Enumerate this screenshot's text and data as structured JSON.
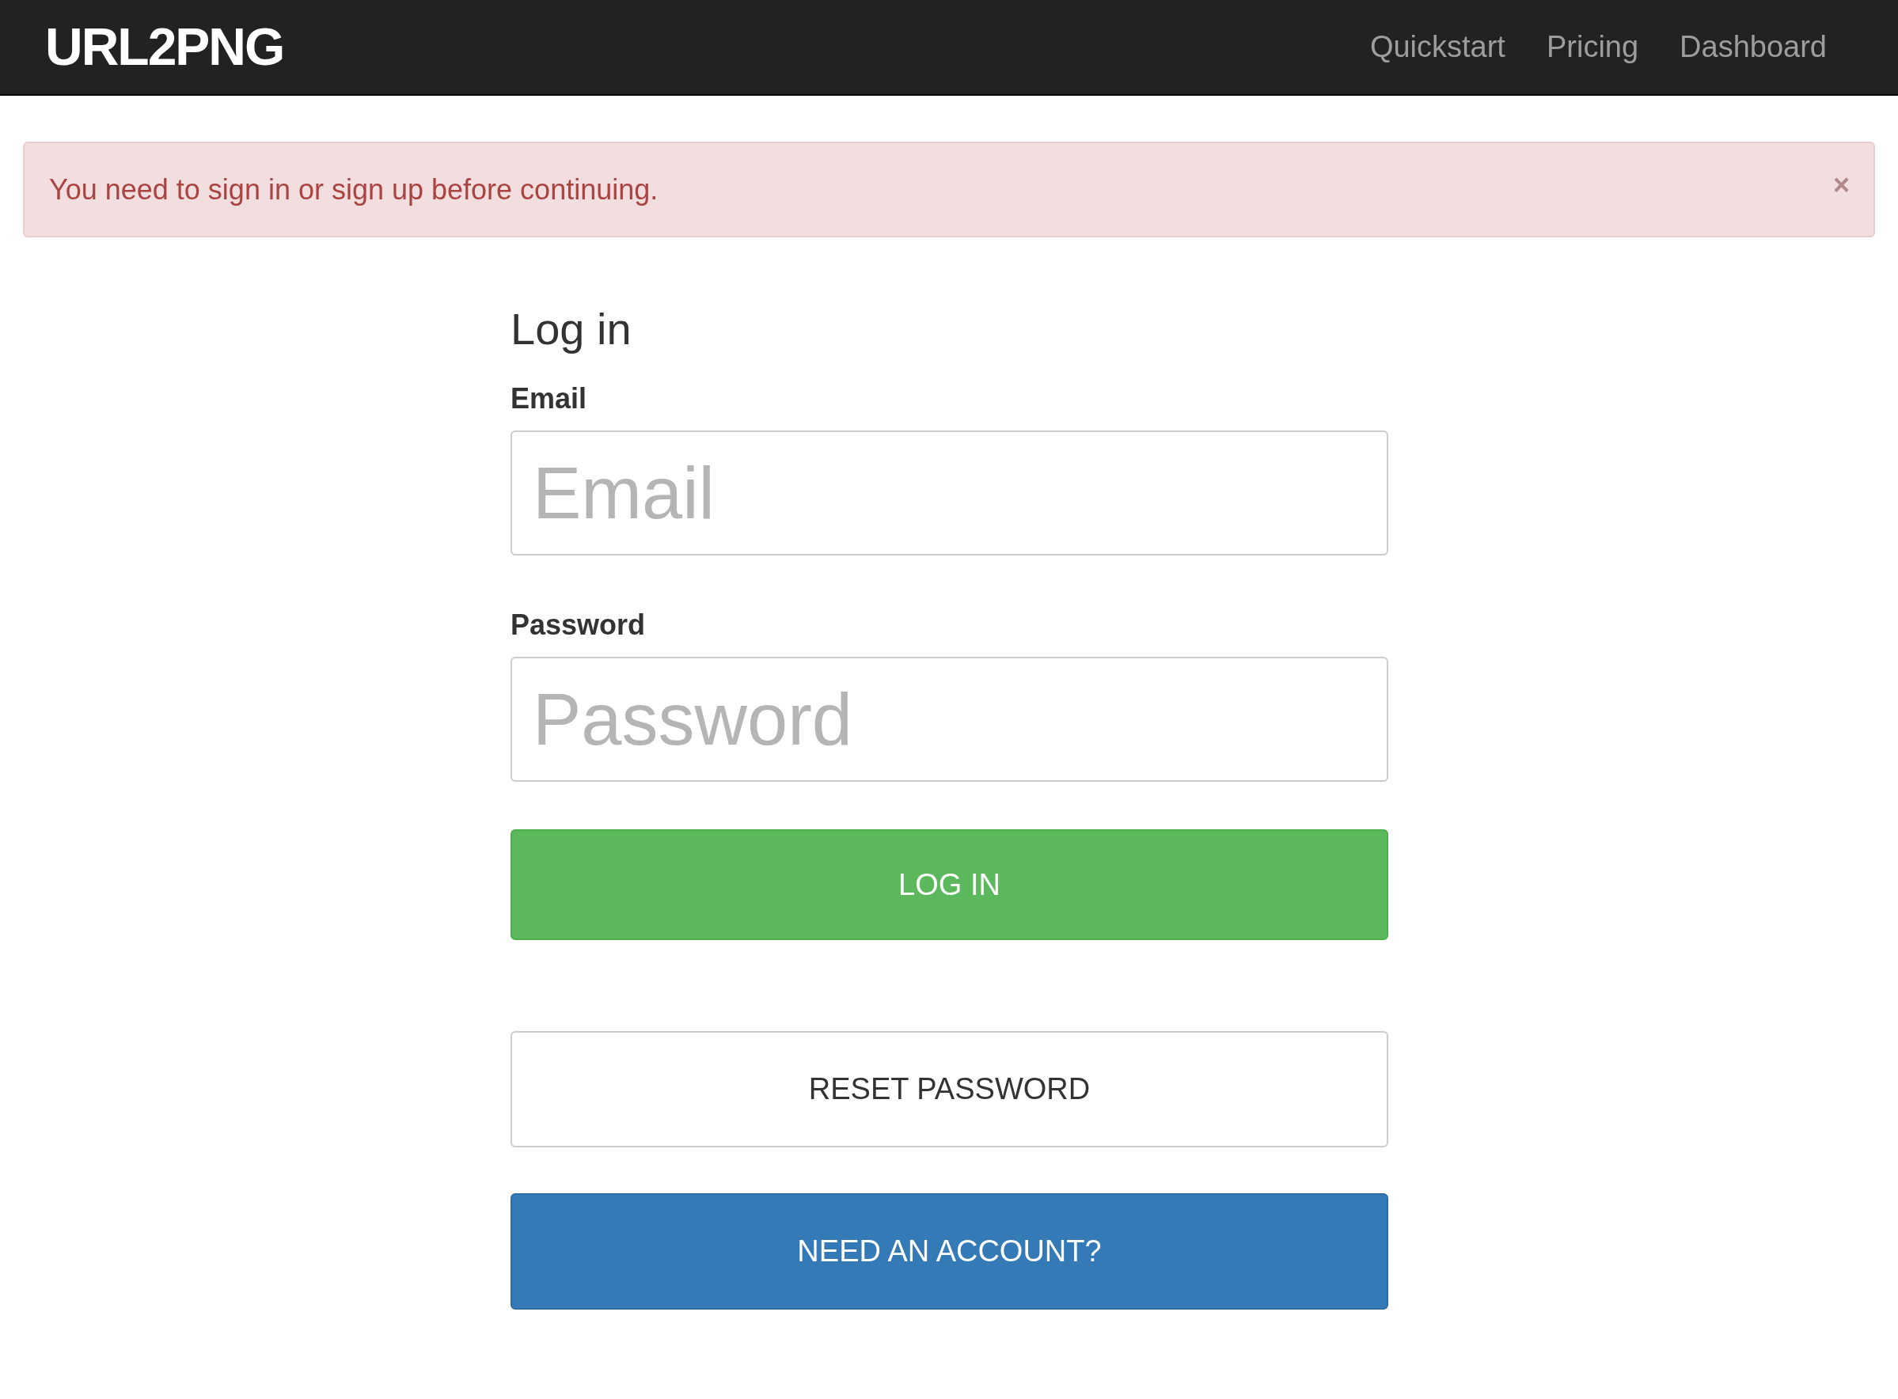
{
  "navbar": {
    "logo": "URL2PNG",
    "links": [
      "Quickstart",
      "Pricing",
      "Dashboard"
    ]
  },
  "alert": {
    "message": "You need to sign in or sign up before continuing.",
    "close": "×"
  },
  "form": {
    "title": "Log in",
    "fields": [
      {
        "label": "Email",
        "placeholder": "Email"
      },
      {
        "label": "Password",
        "placeholder": "Password"
      }
    ],
    "buttons": [
      {
        "label": "LOG IN",
        "kind": "success"
      },
      {
        "label": "RESET PASSWORD",
        "kind": "default"
      },
      {
        "label": "NEED AN ACCOUNT?",
        "kind": "primary"
      }
    ]
  }
}
